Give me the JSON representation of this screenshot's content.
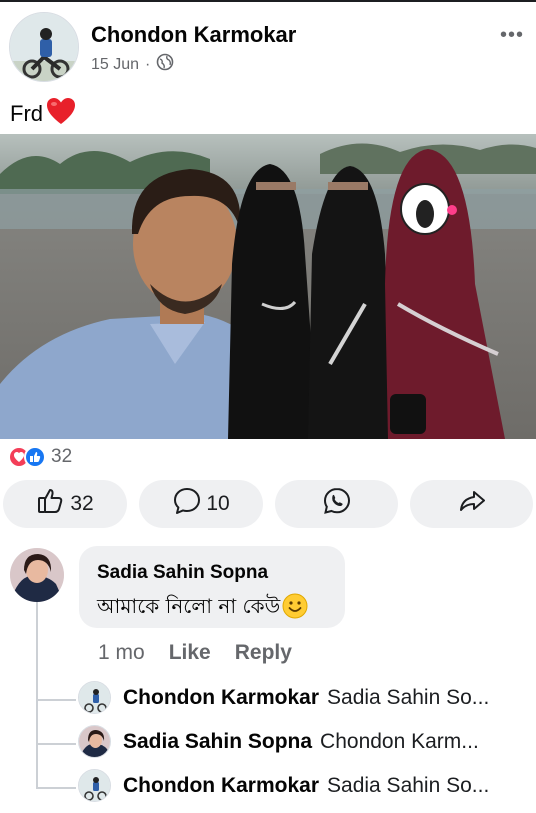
{
  "post": {
    "author": "Chondon Karmokar",
    "date": "15 Jun",
    "separator": "·",
    "caption": "Frd",
    "more": "•••"
  },
  "reactions": {
    "count": "32"
  },
  "actions": {
    "like_count": "32",
    "comment_count": "10"
  },
  "comment": {
    "author": "Sadia Sahin Sopna",
    "text": "আমাকে নিলো না কেউ",
    "age": "1 mo",
    "like": "Like",
    "reply": "Reply"
  },
  "replies": [
    {
      "author": "Chondon Karmokar",
      "preview": "Sadia Sahin So..."
    },
    {
      "author": "Sadia Sahin Sopna",
      "preview": "Chondon Karm..."
    },
    {
      "author": "Chondon Karmokar",
      "preview": "Sadia Sahin So..."
    }
  ],
  "colors": {
    "brand_blue": "#1877f2",
    "love_red": "#f33e58",
    "secondary_text": "#65676b",
    "button_bg": "#eff0f2"
  }
}
